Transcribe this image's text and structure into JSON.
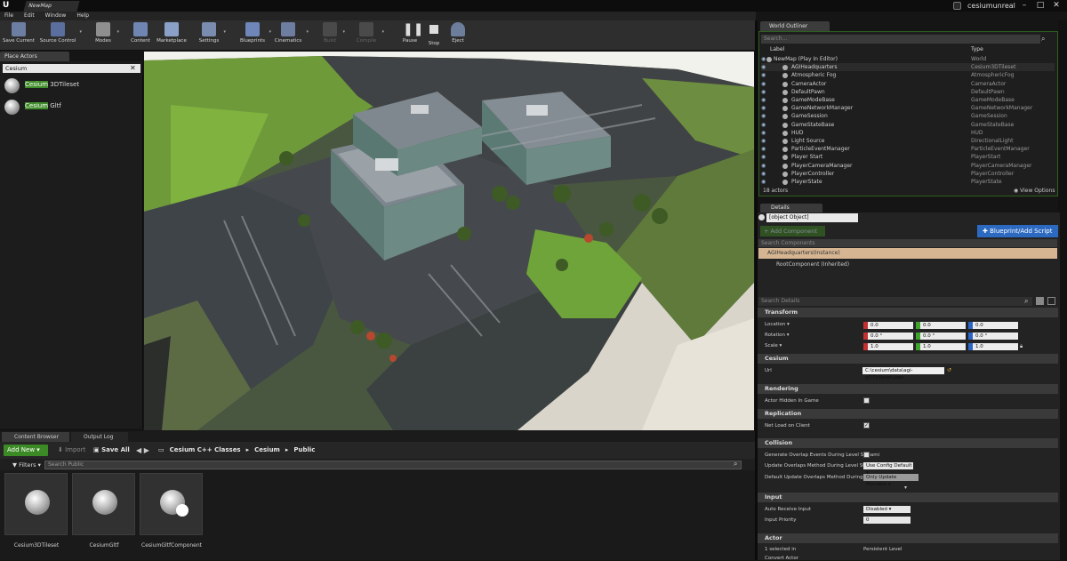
{
  "titlebar": {
    "doc_tab": "NewMap",
    "project": "cesiumunreal",
    "min": "–",
    "max": "□",
    "close": "✕"
  },
  "menu": [
    "File",
    "Edit",
    "Window",
    "Help"
  ],
  "toolbar": {
    "buttons": [
      "Save Current",
      "Source Control",
      "Modes",
      "Content",
      "Marketplace",
      "Settings",
      "Blueprints",
      "Cinematics",
      "Build",
      "Compile",
      "Pause",
      "Stop",
      "Eject"
    ]
  },
  "place_actors": {
    "tab": "Place Actors",
    "search": "Cesium",
    "items": [
      {
        "hl": "Cesium",
        "rest": " 3DTileset"
      },
      {
        "hl": "Cesium",
        "rest": " Gltf"
      }
    ]
  },
  "bottom_tabs": [
    "Content Browser",
    "Output Log"
  ],
  "content_browser": {
    "add_new": "Add New",
    "import": "Import",
    "save_all": "Save All",
    "breadcrumb": [
      "Cesium C++ Classes",
      "Cesium",
      "Public"
    ],
    "filters": "Filters",
    "search_placeholder": "Search Public",
    "assets": [
      "Cesium3DTileset",
      "CesiumGltf",
      "CesiumGltfComponent"
    ]
  },
  "outliner": {
    "tab": "World Outliner",
    "search_placeholder": "Search...",
    "col_label": "Label",
    "col_type": "Type",
    "rows": [
      {
        "label": "NewMap (Play In Editor)",
        "type": "World"
      },
      {
        "label": "AGIHeadquarters",
        "type": "Cesium3DTileset"
      },
      {
        "label": "Atmospheric Fog",
        "type": "AtmosphericFog"
      },
      {
        "label": "CameraActor",
        "type": "CameraActor"
      },
      {
        "label": "DefaultPawn",
        "type": "DefaultPawn"
      },
      {
        "label": "GameModeBase",
        "type": "GameModeBase"
      },
      {
        "label": "GameNetworkManager",
        "type": "GameNetworkManager"
      },
      {
        "label": "GameSession",
        "type": "GameSession"
      },
      {
        "label": "GameStateBase",
        "type": "GameStateBase"
      },
      {
        "label": "HUD",
        "type": "HUD"
      },
      {
        "label": "Light Source",
        "type": "DirectionalLight"
      },
      {
        "label": "ParticleEventManager",
        "type": "ParticleEventManager"
      },
      {
        "label": "Player Start",
        "type": "PlayerStart"
      },
      {
        "label": "PlayerCameraManager",
        "type": "PlayerCameraManager"
      },
      {
        "label": "PlayerController",
        "type": "PlayerController"
      },
      {
        "label": "PlayerState",
        "type": "PlayerState"
      }
    ],
    "count": "18 actors",
    "view_options": "View Options"
  },
  "details": {
    "tab": "Details",
    "actor": {
      "title": "Actor",
      "selected": "1 selected in",
      "selected_val": "Persistent Level",
      "convert": "Convert Actor"
    },
    "add_component": "+ Add Component",
    "blueprint_btn": "Blueprint/Add Script",
    "search_components": "Search Components",
    "instance": "AGIHeadquarters(Instance)",
    "root": "RootComponent (Inherited)",
    "search_details": "Search Details",
    "transform": {
      "title": "Transform",
      "location": "Location",
      "rotation": "Rotation",
      "scale": "Scale",
      "loc": [
        "0.0",
        "0.0",
        "0.0"
      ],
      "rot": [
        "0.0 °",
        "0.0 °",
        "0.0 °"
      ],
      "scl": [
        "1.0",
        "1.0",
        "1.0"
      ]
    },
    "cesium": {
      "title": "Cesium",
      "url_label": "Url",
      "url": "C:\\cesium\\data\\agi-glTF\\tileset.json"
    },
    "rendering": {
      "title": "Rendering",
      "hidden": "Actor Hidden In Game"
    },
    "replication": {
      "title": "Replication",
      "net_load": "Net Load on Client"
    },
    "collision": {
      "title": "Collision",
      "gen": "Generate Overlap Events During Level Streami",
      "update": "Update Overlaps Method During Level Stream",
      "update_val": "Use Config Default",
      "default": "Default Update Overlaps Method During Leve",
      "default_val": "Only Update Movable"
    },
    "input": {
      "title": "Input",
      "auto": "Auto Receive Input",
      "auto_val": "Disabled",
      "priority": "Input Priority",
      "priority_val": "0"
    }
  }
}
